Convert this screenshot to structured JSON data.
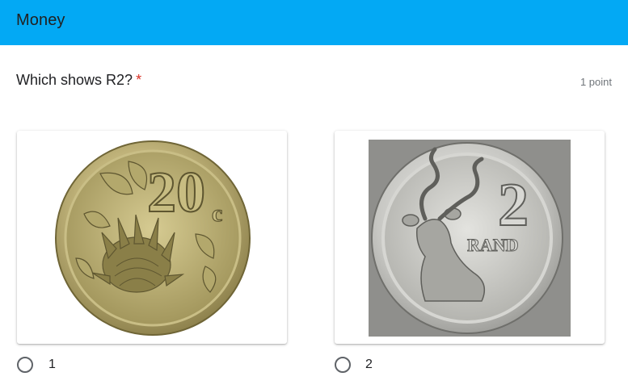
{
  "header": {
    "title": "Money",
    "color": "#03a9f4"
  },
  "question": {
    "text": "Which shows R2?",
    "required_marker": "*",
    "points": "1 point"
  },
  "options": [
    {
      "label": "1",
      "image_icon": "coin-20c-protea-icon",
      "coin_value": "20",
      "coin_unit": "c",
      "selected": false
    },
    {
      "label": "2",
      "image_icon": "coin-r2-kudu-icon",
      "coin_value": "2",
      "coin_unit": "RAND",
      "selected": false
    }
  ]
}
